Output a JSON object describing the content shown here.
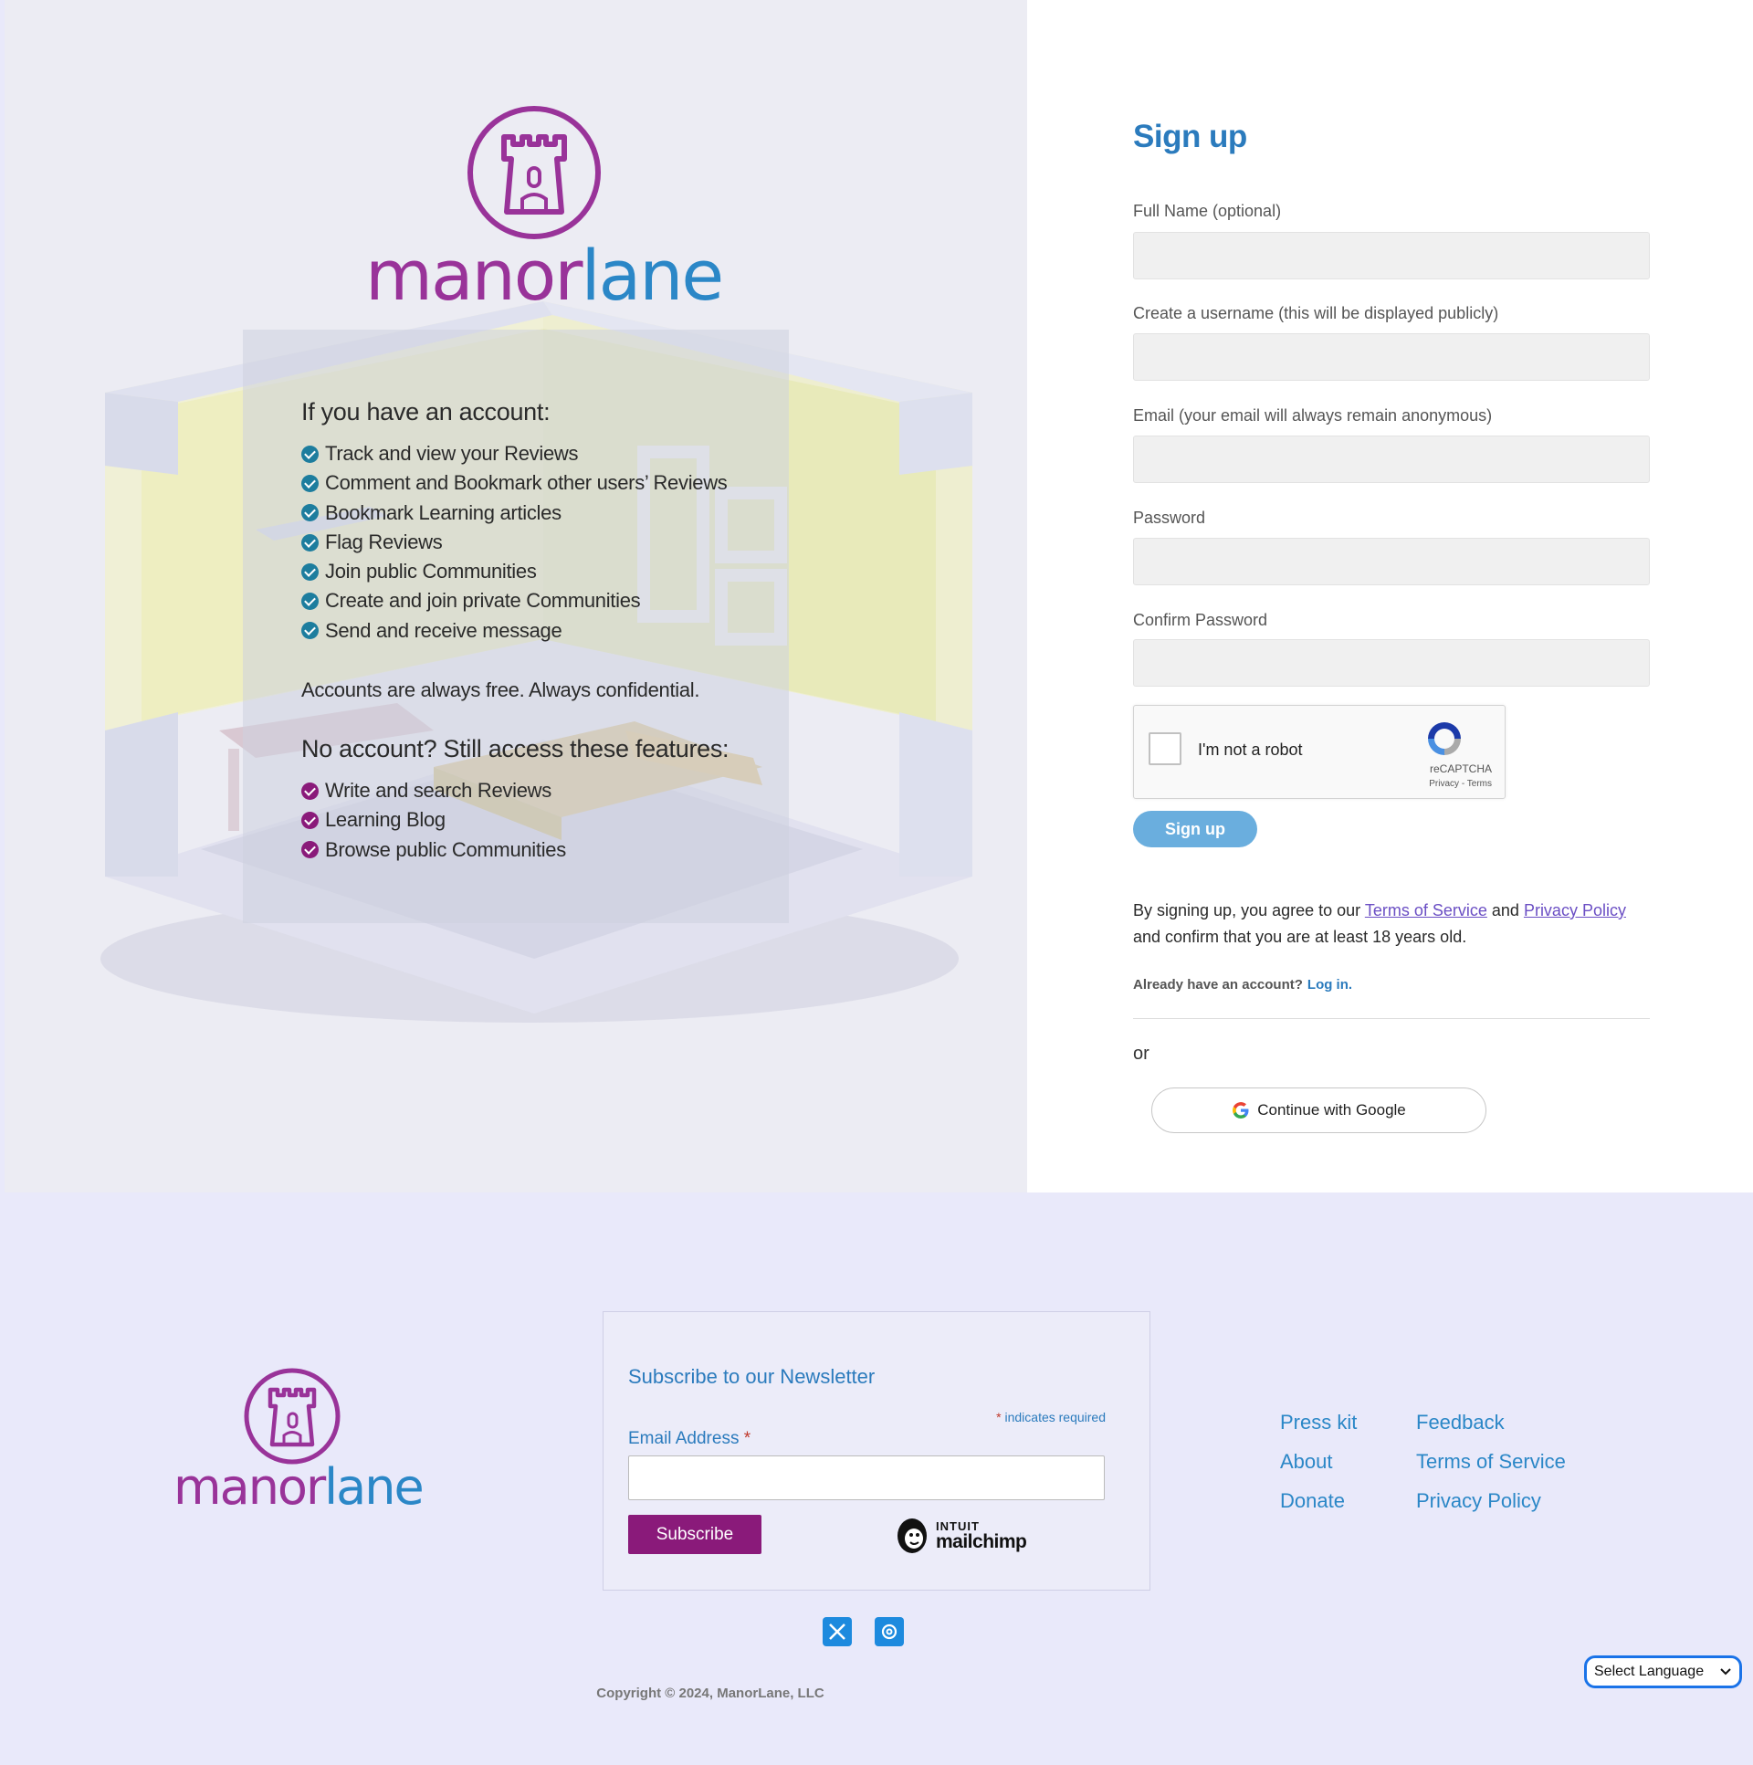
{
  "brand": {
    "part1": "manor",
    "part2": "lane"
  },
  "left": {
    "account_heading": "If you have an account:",
    "account_features": [
      "Track and view your Reviews",
      "Comment and Bookmark other users’ Reviews",
      "Bookmark Learning articles",
      "Flag Reviews",
      "Join public Communities",
      "Create and join private Communities",
      "Send and receive message"
    ],
    "free_note": "Accounts are always free. Always confidential.",
    "noaccount_heading": "No account? Still access these features:",
    "noaccount_features": [
      "Write and search Reviews",
      "Learning Blog",
      "Browse public Communities"
    ]
  },
  "form": {
    "title": "Sign up",
    "fields": [
      {
        "label": "Full Name (optional)",
        "value": ""
      },
      {
        "label": "Create a username (this will be displayed publicly)",
        "value": ""
      },
      {
        "label": "Email (your email will always remain anonymous)",
        "value": ""
      },
      {
        "label": "Password",
        "value": ""
      },
      {
        "label": "Confirm Password",
        "value": ""
      }
    ],
    "captcha": {
      "label": "I'm not a robot",
      "brand": "reCAPTCHA",
      "privacy": "Privacy",
      "sep": " - ",
      "terms": "Terms"
    },
    "submit_label": "Sign up",
    "agree_prefix": "By signing up, you agree to our ",
    "terms_link": "Terms of Service",
    "and": " and ",
    "privacy_link": "Privacy Policy",
    "agree_suffix": "and confirm that you are at least 18 years old.",
    "already_text": "Already have an account?",
    "login_link": "Log in.",
    "or_text": "or",
    "google_label": "Continue with Google"
  },
  "footer": {
    "newsletter": {
      "title": "Subscribe to our Newsletter",
      "required_note": "indicates required",
      "required_mark": "*",
      "email_label": "Email Address",
      "email_value": "",
      "subscribe_label": "Subscribe",
      "mailchimp_line1": "INTUIT",
      "mailchimp_line2": "mailchimp"
    },
    "links_col1": [
      "Press kit",
      "About",
      "Donate"
    ],
    "links_col2": [
      "Feedback",
      "Terms of Service",
      "Privacy Policy"
    ],
    "social_icons": [
      "x-icon",
      "threads-icon"
    ],
    "copyright": "Copyright © 2024, ManorLane, LLC",
    "language_select": "Select Language"
  },
  "colors": {
    "brand_purple": "#993399",
    "brand_blue": "#2b87c7",
    "link_blue": "#2b7bbd",
    "subscribe_purple": "#8a1a7a",
    "signup_button": "#6aaede",
    "footer_bg": "#e9e9fa"
  }
}
